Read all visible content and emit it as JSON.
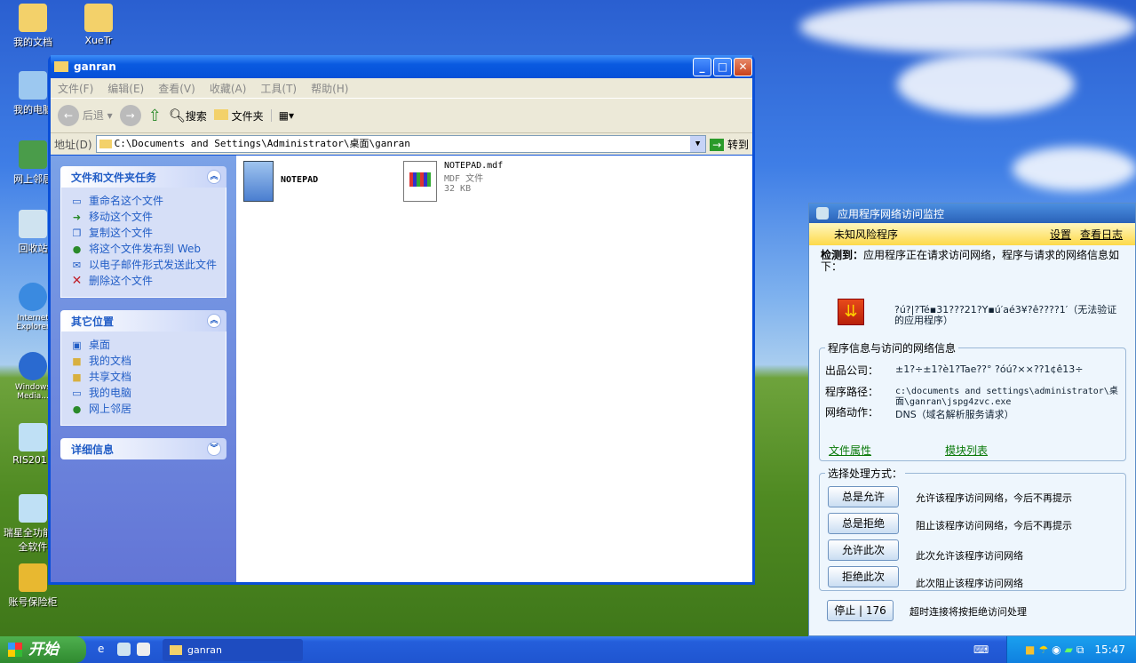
{
  "desktop": {
    "icons": [
      "我的文档",
      "XueTr",
      "我的电脑",
      "网上邻居",
      "回收站",
      "Internet Explorer",
      "Windows Media...",
      "RIS2011",
      "瑞星全功能安全软件",
      "账号保险柜"
    ]
  },
  "explorer": {
    "title": "ganran",
    "menu": [
      "文件(F)",
      "编辑(E)",
      "查看(V)",
      "收藏(A)",
      "工具(T)",
      "帮助(H)"
    ],
    "toolbar": {
      "back": "后退",
      "search": "搜索",
      "folders": "文件夹"
    },
    "address": {
      "label": "地址(D)",
      "value": "C:\\Documents and Settings\\Administrator\\桌面\\ganran",
      "go": "转到"
    },
    "tasks": {
      "title": "文件和文件夹任务",
      "items": [
        "重命名这个文件",
        "移动这个文件",
        "复制这个文件",
        "将这个文件发布到 Web",
        "以电子邮件形式发送此文件",
        "删除这个文件"
      ]
    },
    "places": {
      "title": "其它位置",
      "items": [
        "桌面",
        "我的文档",
        "共享文档",
        "我的电脑",
        "网上邻居"
      ]
    },
    "details": {
      "title": "详细信息"
    },
    "files": [
      {
        "name": "NOTEPAD"
      },
      {
        "name": "NOTEPAD.mdf",
        "type": "MDF 文件",
        "size": "32 KB"
      }
    ]
  },
  "monitor": {
    "title": "应用程序网络访问监控",
    "risk": "未知风险程序",
    "settings": "设置",
    "log": "查看日志",
    "detected_label": "检测到：",
    "detected_text": "应用程序正在请求访问网络，程序与请求的网络信息如下：",
    "program_name": "?ú?|?Té▪31???21?Y▪ú′aé3¥?ê????1′（无法验证的应用程序）",
    "info_title": "程序信息与访问的网络信息",
    "publisher_label": "出品公司：",
    "publisher": "±1?÷±1?è1?Tae??° ?óú?××??1¢ê13÷",
    "path_label": "程序路径：",
    "path": "c:\\documents and settings\\administrator\\桌面\\ganran\\jspg4zvc.exe",
    "action_label": "网络动作：",
    "action": "DNS（域名解析服务请求）",
    "file_props": "文件属性",
    "module_list": "模块列表",
    "choose_title": "选择处理方式：",
    "options": [
      {
        "button": "总是允许",
        "desc": "允许该程序访问网络，今后不再提示"
      },
      {
        "button": "总是拒绝",
        "desc": "阻止该程序访问网络，今后不再提示"
      },
      {
        "button": "允许此次",
        "desc": "此次允许该程序访问网络"
      },
      {
        "button": "拒绝此次",
        "desc": "此次阻止该程序访问网络"
      }
    ],
    "stop": "停止 | 176",
    "timeout_text": "超时连接将按拒绝访问处理"
  },
  "taskbar": {
    "start": "开始",
    "task": "ganran",
    "clock": "15:47"
  }
}
